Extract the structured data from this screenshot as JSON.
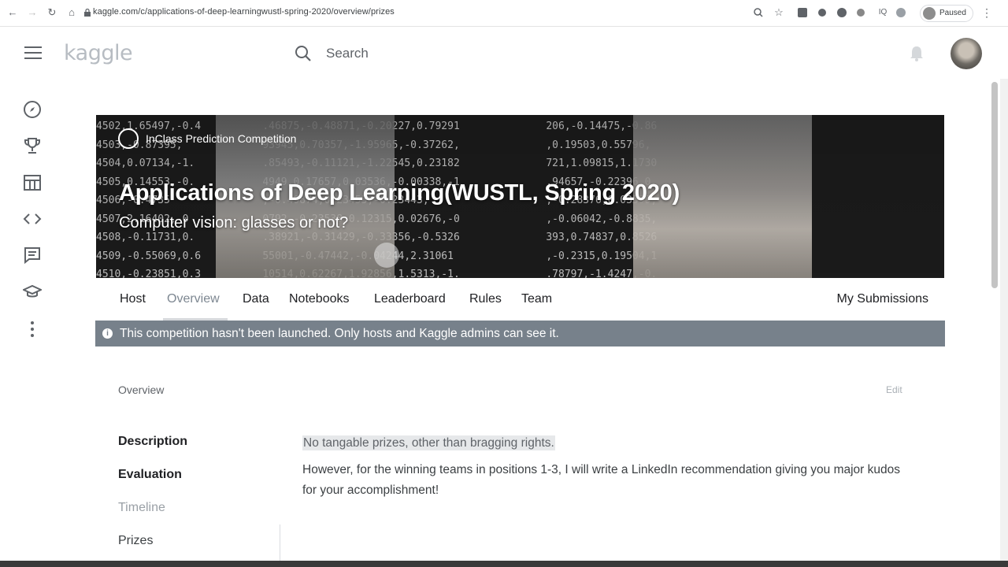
{
  "browser": {
    "url": "kaggle.com/c/applications-of-deep-learningwustl-spring-2020/overview/prizes",
    "profile_status": "Paused"
  },
  "header": {
    "logo": "kaggle",
    "search_placeholder": "Search"
  },
  "banner": {
    "badge": "InClass Prediction Competition",
    "title": "Applications of Deep Learning(WUSTL, Spring 2020)",
    "subtitle": "Computer vision: glasses or not?",
    "number_rows": [
      "4502,1.65497,-0.4          .46875,-0.48871,-0.20227,0.79291              206,-0.14475,-0.86",
      "4503,-0.87395,             93945,0.70357,-1.95965,-0.37262,              ,0.19503,0.55796,",
      "4504,0.07134,-1.           .85493,-0.11121,-1.22545,0.23182              721,1.09815,1.1730",
      "4505,0.14553,-0.           4949,0.17657,0.03536,-0.00338,-1              .94657,-0.22396,0.",
      "4506,-0.4735               ,-0.49874,0.23453,-0.23443,                   ,-0.28376,0.03599,",
      "4507,2.16402,-0            0792,-0.23538,0.12315,0.02676,-0              ,-0.06042,-0.8835,",
      "4508,-0.11731,0.           .38921,-0.31429,-0.33356,-0.5326              393,0.74837,0.8526",
      "4509,-0.55069,0.6          55001,-0.47442,-0.04244,2.31061               ,-0.2315,0.19504,1",
      "4510,-0.23851,0.3          10514,0.62267,1.92856,1.5313,-1.              .78797,-1.4247,-0."
    ]
  },
  "tabs": [
    "Host",
    "Overview",
    "Data",
    "Notebooks",
    "Leaderboard",
    "Rules",
    "Team"
  ],
  "active_tab": "Overview",
  "my_submissions": "My Submissions",
  "alert": "This competition hasn't been launched. Only hosts and Kaggle admins can see it.",
  "overview": {
    "section_title": "Overview",
    "edit": "Edit",
    "nav": [
      {
        "label": "Description",
        "style": "bold"
      },
      {
        "label": "Evaluation",
        "style": "bold"
      },
      {
        "label": "Timeline",
        "style": "muted"
      },
      {
        "label": "Prizes",
        "style": "normal"
      }
    ],
    "highlight": "No tangable prizes, other than bragging rights.",
    "paragraph": "However, for the winning teams in positions 1-3, I will write a LinkedIn recommendation giving you major kudos for your accomplishment!"
  },
  "colors": {
    "alert_bg": "#77818b",
    "active_tab": "#7d8791",
    "logo": "#b7bcc2"
  }
}
